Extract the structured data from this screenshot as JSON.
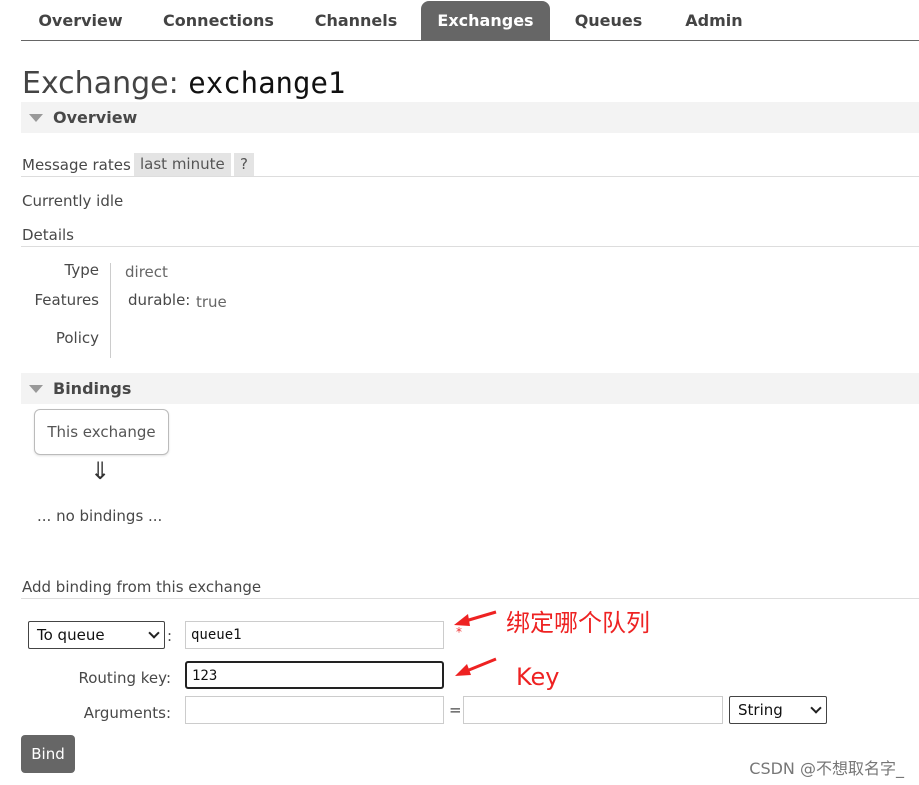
{
  "nav": {
    "tabs": [
      {
        "label": "Overview",
        "active": false
      },
      {
        "label": "Connections",
        "active": false
      },
      {
        "label": "Channels",
        "active": false
      },
      {
        "label": "Exchanges",
        "active": true
      },
      {
        "label": "Queues",
        "active": false
      },
      {
        "label": "Admin",
        "active": false
      }
    ]
  },
  "page": {
    "title_prefix": "Exchange:",
    "exchange_name": "exchange1"
  },
  "overview": {
    "section_label": "Overview",
    "message_rates_label": "Message rates",
    "rate_period": "last minute",
    "help": "?",
    "status": "Currently idle",
    "details_label": "Details",
    "details": {
      "type_label": "Type",
      "type_value": "direct",
      "features_label": "Features",
      "durable_key": "durable:",
      "durable_value": "true",
      "policy_label": "Policy"
    }
  },
  "bindings": {
    "section_label": "Bindings",
    "this_exchange": "This exchange",
    "arrow": "⇓",
    "empty_text": "... no bindings ..."
  },
  "add_binding": {
    "title": "Add binding from this exchange",
    "destination_type": "To queue",
    "destination_value": "queue1",
    "required_mark": "*",
    "routing_key_label": "Routing key:",
    "routing_key_value": "123",
    "arguments_label": "Arguments:",
    "arg_key": "",
    "arg_equals": "=",
    "arg_value": "",
    "arg_type": "String",
    "colon": ":",
    "bind_button": "Bind"
  },
  "annotations": {
    "queue_note": "绑定哪个队列",
    "key_note": "Key",
    "color": "#ee2222"
  },
  "watermark": "CSDN @不想取名字_"
}
